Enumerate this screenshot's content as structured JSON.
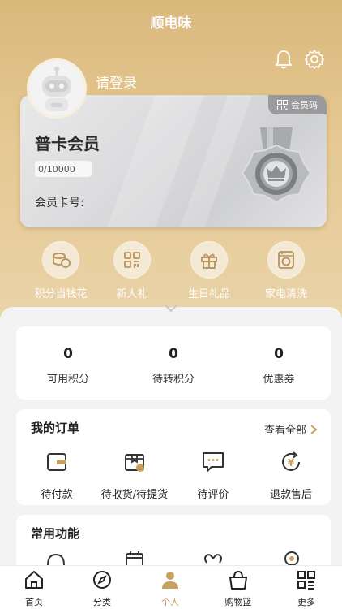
{
  "header": {
    "title": "顺电味"
  },
  "profile": {
    "login_text": "请登录",
    "avatar_alt": "avatar"
  },
  "card": {
    "member_code_label": "会员码",
    "tier": "普卡会员",
    "points_progress": "0/10000",
    "card_number_label": "会员卡号:"
  },
  "quick_actions": [
    {
      "label": "积分当钱花",
      "icon": "coins-icon"
    },
    {
      "label": "新人礼",
      "icon": "grid-icon"
    },
    {
      "label": "生日礼品",
      "icon": "gift-icon"
    },
    {
      "label": "家电清洗",
      "icon": "washer-icon"
    }
  ],
  "stats": [
    {
      "value": "0",
      "label": "可用积分"
    },
    {
      "value": "0",
      "label": "待转积分"
    },
    {
      "value": "0",
      "label": "优惠券"
    }
  ],
  "orders": {
    "title": "我的订单",
    "see_all": "查看全部",
    "items": [
      {
        "label": "待付款",
        "icon": "wallet-icon"
      },
      {
        "label": "待收货/待提货",
        "icon": "package-icon"
      },
      {
        "label": "待评价",
        "icon": "comment-icon"
      },
      {
        "label": "退款售后",
        "icon": "refund-icon"
      }
    ]
  },
  "common": {
    "title": "常用功能"
  },
  "tabbar": [
    {
      "label": "首页",
      "icon": "home-icon"
    },
    {
      "label": "分类",
      "icon": "compass-icon"
    },
    {
      "label": "个人",
      "icon": "person-icon",
      "active": true
    },
    {
      "label": "购物篮",
      "icon": "basket-icon"
    },
    {
      "label": "更多",
      "icon": "more-icon"
    }
  ],
  "colors": {
    "gold": "#d9b87b",
    "accent": "#c9a15e"
  }
}
